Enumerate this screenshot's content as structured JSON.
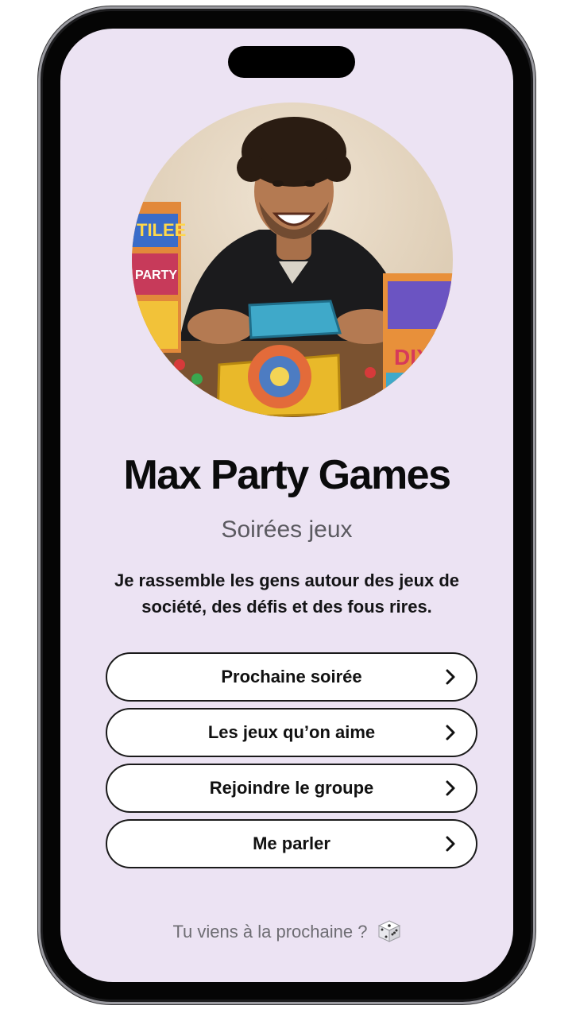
{
  "profile": {
    "name": "Max Party Games",
    "subtitle": "Soirées jeux",
    "bio": "Je rassemble les gens autour des jeux de société, des défis et des fous rires."
  },
  "links": [
    {
      "label": "Prochaine soirée",
      "icon": "chevron-right-icon"
    },
    {
      "label": "Les jeux qu’on aime",
      "icon": "chevron-right-icon"
    },
    {
      "label": "Rejoindre le groupe",
      "icon": "chevron-right-icon"
    },
    {
      "label": "Me parler",
      "icon": "chevron-right-icon"
    }
  ],
  "footer": {
    "text": "Tu viens à la prochaine ?",
    "icon": "dice-icon"
  },
  "avatar": {
    "box_texts": [
      "TILEE",
      "PARTY",
      "DIXIT"
    ]
  },
  "colors": {
    "background": "#ece3f3",
    "text": "#0b0b0c",
    "subtitle": "#5b5a60",
    "button_bg": "#ffffff",
    "button_border": "#1a1a1a"
  }
}
